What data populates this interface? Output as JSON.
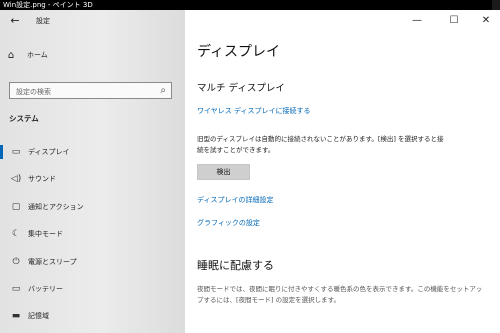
{
  "window_title": "Win設定.png - ペイント 3D",
  "app": {
    "back_icon": "back-arrow-icon",
    "title": "設定"
  },
  "window_controls": {
    "minimize": "—",
    "maximize": "☐",
    "close": "✕"
  },
  "sidebar": {
    "home": {
      "icon": "home-icon",
      "label": "ホーム"
    },
    "search": {
      "placeholder": "設定の検索",
      "icon": "search-icon"
    },
    "section": "システム",
    "items": [
      {
        "icon": "display-icon",
        "label": "ディスプレイ",
        "selected": true
      },
      {
        "icon": "speaker-icon",
        "label": "サウンド",
        "selected": false
      },
      {
        "icon": "notification-icon",
        "label": "通知とアクション",
        "selected": false
      },
      {
        "icon": "focus-moon-icon",
        "label": "集中モード",
        "selected": false
      },
      {
        "icon": "power-icon",
        "label": "電源とスリープ",
        "selected": false
      },
      {
        "icon": "battery-icon",
        "label": "バッテリー",
        "selected": false
      },
      {
        "icon": "storage-icon",
        "label": "記憶域",
        "selected": false
      }
    ]
  },
  "main": {
    "title": "ディスプレイ",
    "multi_display_heading": "マルチ ディスプレイ",
    "wireless_link": "ワイヤレス ディスプレイに接続する",
    "detect_text_1": "旧型のディスプレイは自動的に接続されないことがあります。[検出] を選択すると接",
    "detect_text_2": "続を試すことができます。",
    "detect_button": "検出",
    "advanced_link": "ディスプレイの詳細設定",
    "graphics_link": "グラフィックの設定",
    "sleep_heading": "睡眠に配慮する",
    "sleep_text_1": "夜間モードでは、夜間に眠りに付きやすくする暖色系の色を表示できます。この機能をセットアッ",
    "sleep_text_2": "プするには、[夜間モード] の設定を選択します。"
  },
  "colors": {
    "accent": "#0067b8",
    "sidebar_bg": "#e6e6e6",
    "button_bg": "#cccccc"
  }
}
